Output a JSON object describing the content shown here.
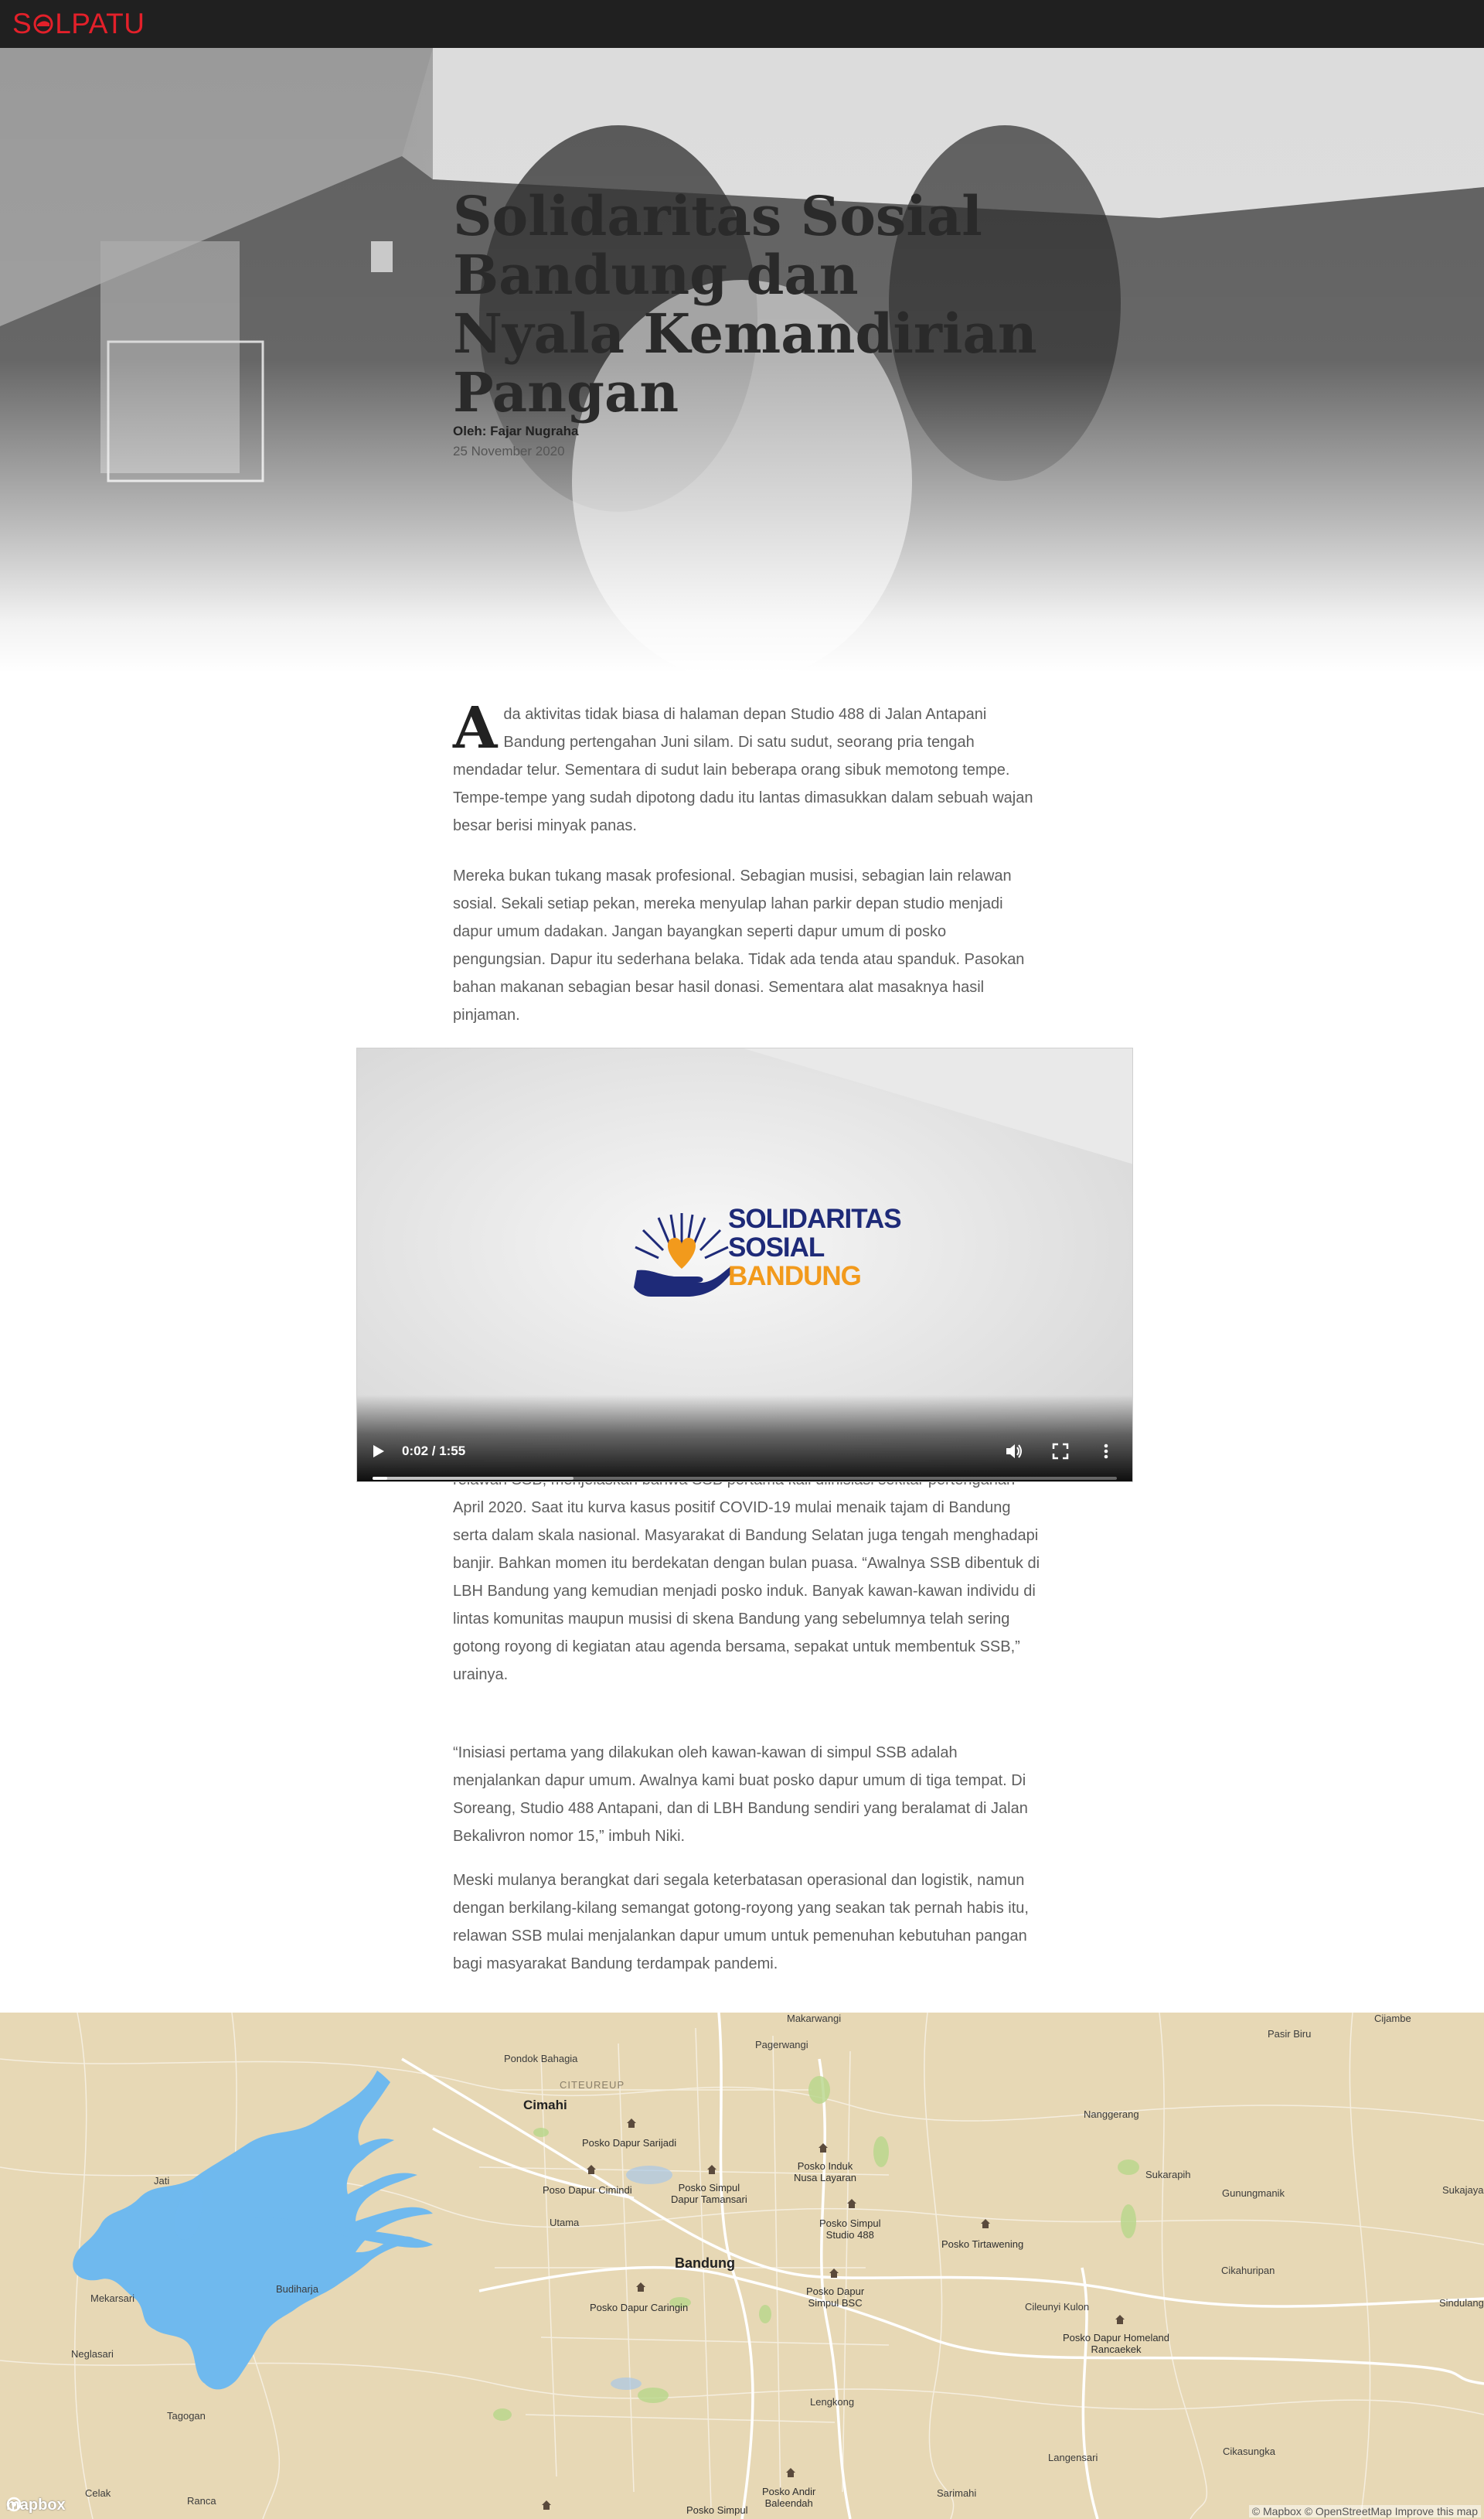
{
  "site": {
    "logo_text": "SOLPATU",
    "logo_s": "S",
    "logo_rest": "LPATU",
    "brand_color": "#e3202a",
    "topbar_color": "#202020"
  },
  "hero": {
    "title": "Solidaritas Sosial Bandung dan Nyala Kemandirian Pangan",
    "byline": "Oleh: Fajar Nugraha",
    "date": "25 November 2020"
  },
  "article": {
    "dropcap": "A",
    "p1": "da aktivitas tidak biasa di halaman depan Studio 488 di Jalan Antapani Bandung pertengahan Juni silam. Di satu sudut, seorang pria tengah mendadar telur. Sementara di sudut lain beberapa orang sibuk memotong tempe. Tempe-tempe yang sudah dipotong dadu itu lantas dimasukkan dalam sebuah wajan besar berisi minyak panas.",
    "p2": "Mereka bukan tukang masak profesional. Sebagian musisi, sebagian lain relawan sosial. Sekali setiap pekan, mereka menyulap lahan parkir depan studio menjadi dapur umum dadakan. Jangan bayangkan seperti dapur umum di posko pengungsian. Dapur itu sederhana belaka. Tidak ada tenda atau spanduk. Pasokan bahan makanan sebagian besar hasil donasi. Sementara alat masaknya hasil pinjaman.",
    "p3": "relawan SSB, menjelaskan bahwa SSB pertama kali diinisiasi sekitar pertengahan April 2020. Saat itu kurva kasus positif COVID-19 mulai menaik tajam di Bandung serta dalam skala nasional. Masyarakat di Bandung Selatan juga tengah menghadapi banjir. Bahkan momen itu berdekatan dengan bulan puasa. “Awalnya SSB dibentuk di LBH Bandung yang kemudian menjadi posko induk. Banyak kawan-kawan individu di lintas komunitas maupun musisi di skena Bandung yang sebelumnya telah sering gotong royong di kegiatan atau agenda bersama, sepakat untuk membentuk SSB,” urainya.",
    "p4": "“Inisiasi pertama yang dilakukan oleh kawan-kawan di simpul SSB adalah menjalankan dapur umum. Awalnya kami buat posko dapur umum di tiga tempat. Di Soreang, Studio 488 Antapani, dan di LBH Bandung sendiri yang beralamat di Jalan Bekalivron nomor 15,” imbuh Niki.",
    "p5": "Meski mulanya berangkat dari segala keterbatasan operasional dan logistik, namun dengan berkilang-kilang semangat gotong-royong yang seakan tak pernah habis itu, relawan SSB mulai menjalankan dapur umum untuk pemenuhan kebutuhan pangan bagi masyarakat Bandung terdampak pandemi."
  },
  "video": {
    "logo_line1": "SOLIDARITAS",
    "logo_line2": "SOSIAL",
    "logo_line3": "BANDUNG",
    "time": "0:02 / 1:55",
    "played_fraction": 0.02,
    "buffered_fraction": 0.27,
    "colors": {
      "navy": "#1e2a78",
      "orange": "#f29a1c"
    },
    "icons": [
      "play-icon",
      "volume-icon",
      "fullscreen-icon",
      "more-options-icon"
    ]
  },
  "map": {
    "labels": {
      "makarwangi": "Makarwangi",
      "pagerwangi": "Pagerwangi",
      "pondok_bahagia": "Pondok Bahagia",
      "citeureup": "CITEUREUP",
      "cimahi": "Cimahi",
      "nanggerang": "Nanggerang",
      "pasir_biru": "Pasir Biru",
      "sukarapih": "Sukarapih",
      "gunungmanik": "Gunungmanik",
      "sukajaya": "Sukajaya",
      "jati": "Jati",
      "utama": "Utama",
      "bandung": "Bandung",
      "cikahuripan": "Cikahuripan",
      "sindulang": "Sindulang",
      "mekarsari": "Mekarsari",
      "budiharja": "Budiharja",
      "cileunyi_kulon": "Cileunyi Kulon",
      "neglasari": "Neglasari",
      "tagogan": "Tagogan",
      "lengkong": "Lengkong",
      "langensari": "Langensari",
      "cikasungka": "Cikasungka",
      "celak": "Celak",
      "ranca": "Ranca",
      "sarimahi": "Sarimahi",
      "cijambe": "Cijambe"
    },
    "posko": {
      "sarijadi": "Posko Dapur Sarijadi",
      "cimindi": "Poso Dapur Cimindi",
      "tamansari_1": "Posko Simpul",
      "tamansari_2": "Dapur Tamansari",
      "induk_1": "Posko Induk",
      "induk_2": "Nusa Layaran",
      "studio_1": "Posko Simpul",
      "studio_2": "Studio 488",
      "tirtawening": "Posko Tirtawening",
      "caringin": "Posko Dapur Caringin",
      "bsc_1": "Posko Dapur",
      "bsc_2": "Simpul BSC",
      "homeland_1": "Posko Dapur Homeland",
      "homeland_2": "Rancaekek",
      "andir_1": "Posko Andir",
      "andir_2": "Baleendah",
      "bottom": "Posko Simpul"
    },
    "attribution": "© Mapbox © OpenStreetMap Improve this map",
    "mapbox_logo": "mapbox",
    "colors": {
      "land": "#e7d8b5",
      "water": "#6fb9ee",
      "roads": "#ffffff",
      "parks": "#b8d78b"
    }
  }
}
